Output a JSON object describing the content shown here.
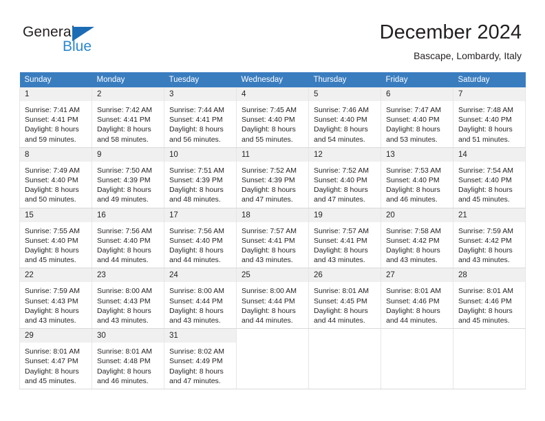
{
  "brand": {
    "name_part1": "General",
    "name_part2": "Blue",
    "triangle_icon": "triangle-logo-icon",
    "accent_color": "#2a87d0"
  },
  "header": {
    "title": "December 2024",
    "subtitle": "Bascape, Lombardy, Italy"
  },
  "calendar": {
    "header_color": "#3a7dbf",
    "weekdays": [
      "Sunday",
      "Monday",
      "Tuesday",
      "Wednesday",
      "Thursday",
      "Friday",
      "Saturday"
    ],
    "weeks": [
      [
        {
          "day": "1",
          "sunrise": "Sunrise: 7:41 AM",
          "sunset": "Sunset: 4:41 PM",
          "daylight1": "Daylight: 8 hours",
          "daylight2": "and 59 minutes."
        },
        {
          "day": "2",
          "sunrise": "Sunrise: 7:42 AM",
          "sunset": "Sunset: 4:41 PM",
          "daylight1": "Daylight: 8 hours",
          "daylight2": "and 58 minutes."
        },
        {
          "day": "3",
          "sunrise": "Sunrise: 7:44 AM",
          "sunset": "Sunset: 4:41 PM",
          "daylight1": "Daylight: 8 hours",
          "daylight2": "and 56 minutes."
        },
        {
          "day": "4",
          "sunrise": "Sunrise: 7:45 AM",
          "sunset": "Sunset: 4:40 PM",
          "daylight1": "Daylight: 8 hours",
          "daylight2": "and 55 minutes."
        },
        {
          "day": "5",
          "sunrise": "Sunrise: 7:46 AM",
          "sunset": "Sunset: 4:40 PM",
          "daylight1": "Daylight: 8 hours",
          "daylight2": "and 54 minutes."
        },
        {
          "day": "6",
          "sunrise": "Sunrise: 7:47 AM",
          "sunset": "Sunset: 4:40 PM",
          "daylight1": "Daylight: 8 hours",
          "daylight2": "and 53 minutes."
        },
        {
          "day": "7",
          "sunrise": "Sunrise: 7:48 AM",
          "sunset": "Sunset: 4:40 PM",
          "daylight1": "Daylight: 8 hours",
          "daylight2": "and 51 minutes."
        }
      ],
      [
        {
          "day": "8",
          "sunrise": "Sunrise: 7:49 AM",
          "sunset": "Sunset: 4:40 PM",
          "daylight1": "Daylight: 8 hours",
          "daylight2": "and 50 minutes."
        },
        {
          "day": "9",
          "sunrise": "Sunrise: 7:50 AM",
          "sunset": "Sunset: 4:39 PM",
          "daylight1": "Daylight: 8 hours",
          "daylight2": "and 49 minutes."
        },
        {
          "day": "10",
          "sunrise": "Sunrise: 7:51 AM",
          "sunset": "Sunset: 4:39 PM",
          "daylight1": "Daylight: 8 hours",
          "daylight2": "and 48 minutes."
        },
        {
          "day": "11",
          "sunrise": "Sunrise: 7:52 AM",
          "sunset": "Sunset: 4:39 PM",
          "daylight1": "Daylight: 8 hours",
          "daylight2": "and 47 minutes."
        },
        {
          "day": "12",
          "sunrise": "Sunrise: 7:52 AM",
          "sunset": "Sunset: 4:40 PM",
          "daylight1": "Daylight: 8 hours",
          "daylight2": "and 47 minutes."
        },
        {
          "day": "13",
          "sunrise": "Sunrise: 7:53 AM",
          "sunset": "Sunset: 4:40 PM",
          "daylight1": "Daylight: 8 hours",
          "daylight2": "and 46 minutes."
        },
        {
          "day": "14",
          "sunrise": "Sunrise: 7:54 AM",
          "sunset": "Sunset: 4:40 PM",
          "daylight1": "Daylight: 8 hours",
          "daylight2": "and 45 minutes."
        }
      ],
      [
        {
          "day": "15",
          "sunrise": "Sunrise: 7:55 AM",
          "sunset": "Sunset: 4:40 PM",
          "daylight1": "Daylight: 8 hours",
          "daylight2": "and 45 minutes."
        },
        {
          "day": "16",
          "sunrise": "Sunrise: 7:56 AM",
          "sunset": "Sunset: 4:40 PM",
          "daylight1": "Daylight: 8 hours",
          "daylight2": "and 44 minutes."
        },
        {
          "day": "17",
          "sunrise": "Sunrise: 7:56 AM",
          "sunset": "Sunset: 4:40 PM",
          "daylight1": "Daylight: 8 hours",
          "daylight2": "and 44 minutes."
        },
        {
          "day": "18",
          "sunrise": "Sunrise: 7:57 AM",
          "sunset": "Sunset: 4:41 PM",
          "daylight1": "Daylight: 8 hours",
          "daylight2": "and 43 minutes."
        },
        {
          "day": "19",
          "sunrise": "Sunrise: 7:57 AM",
          "sunset": "Sunset: 4:41 PM",
          "daylight1": "Daylight: 8 hours",
          "daylight2": "and 43 minutes."
        },
        {
          "day": "20",
          "sunrise": "Sunrise: 7:58 AM",
          "sunset": "Sunset: 4:42 PM",
          "daylight1": "Daylight: 8 hours",
          "daylight2": "and 43 minutes."
        },
        {
          "day": "21",
          "sunrise": "Sunrise: 7:59 AM",
          "sunset": "Sunset: 4:42 PM",
          "daylight1": "Daylight: 8 hours",
          "daylight2": "and 43 minutes."
        }
      ],
      [
        {
          "day": "22",
          "sunrise": "Sunrise: 7:59 AM",
          "sunset": "Sunset: 4:43 PM",
          "daylight1": "Daylight: 8 hours",
          "daylight2": "and 43 minutes."
        },
        {
          "day": "23",
          "sunrise": "Sunrise: 8:00 AM",
          "sunset": "Sunset: 4:43 PM",
          "daylight1": "Daylight: 8 hours",
          "daylight2": "and 43 minutes."
        },
        {
          "day": "24",
          "sunrise": "Sunrise: 8:00 AM",
          "sunset": "Sunset: 4:44 PM",
          "daylight1": "Daylight: 8 hours",
          "daylight2": "and 43 minutes."
        },
        {
          "day": "25",
          "sunrise": "Sunrise: 8:00 AM",
          "sunset": "Sunset: 4:44 PM",
          "daylight1": "Daylight: 8 hours",
          "daylight2": "and 44 minutes."
        },
        {
          "day": "26",
          "sunrise": "Sunrise: 8:01 AM",
          "sunset": "Sunset: 4:45 PM",
          "daylight1": "Daylight: 8 hours",
          "daylight2": "and 44 minutes."
        },
        {
          "day": "27",
          "sunrise": "Sunrise: 8:01 AM",
          "sunset": "Sunset: 4:46 PM",
          "daylight1": "Daylight: 8 hours",
          "daylight2": "and 44 minutes."
        },
        {
          "day": "28",
          "sunrise": "Sunrise: 8:01 AM",
          "sunset": "Sunset: 4:46 PM",
          "daylight1": "Daylight: 8 hours",
          "daylight2": "and 45 minutes."
        }
      ],
      [
        {
          "day": "29",
          "sunrise": "Sunrise: 8:01 AM",
          "sunset": "Sunset: 4:47 PM",
          "daylight1": "Daylight: 8 hours",
          "daylight2": "and 45 minutes."
        },
        {
          "day": "30",
          "sunrise": "Sunrise: 8:01 AM",
          "sunset": "Sunset: 4:48 PM",
          "daylight1": "Daylight: 8 hours",
          "daylight2": "and 46 minutes."
        },
        {
          "day": "31",
          "sunrise": "Sunrise: 8:02 AM",
          "sunset": "Sunset: 4:49 PM",
          "daylight1": "Daylight: 8 hours",
          "daylight2": "and 47 minutes."
        },
        {
          "day": "",
          "sunrise": "",
          "sunset": "",
          "daylight1": "",
          "daylight2": ""
        },
        {
          "day": "",
          "sunrise": "",
          "sunset": "",
          "daylight1": "",
          "daylight2": ""
        },
        {
          "day": "",
          "sunrise": "",
          "sunset": "",
          "daylight1": "",
          "daylight2": ""
        },
        {
          "day": "",
          "sunrise": "",
          "sunset": "",
          "daylight1": "",
          "daylight2": ""
        }
      ]
    ]
  }
}
